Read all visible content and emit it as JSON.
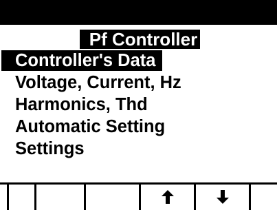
{
  "header": {
    "title": "Pf Controller"
  },
  "menu": {
    "items": [
      {
        "label": "Controller's Data",
        "selected": true
      },
      {
        "label": "Voltage, Current, Hz",
        "selected": false
      },
      {
        "label": "Harmonics, Thd",
        "selected": false
      },
      {
        "label": "Automatic Setting",
        "selected": false
      },
      {
        "label": "Settings",
        "selected": false
      }
    ]
  },
  "softkeys": [
    {
      "icon": ""
    },
    {
      "icon": ""
    },
    {
      "icon": ""
    },
    {
      "icon": "arrow-up-icon"
    },
    {
      "icon": "arrow-down-icon"
    },
    {
      "icon": ""
    }
  ],
  "colors": {
    "background": "#ffffff",
    "foreground": "#000000"
  }
}
